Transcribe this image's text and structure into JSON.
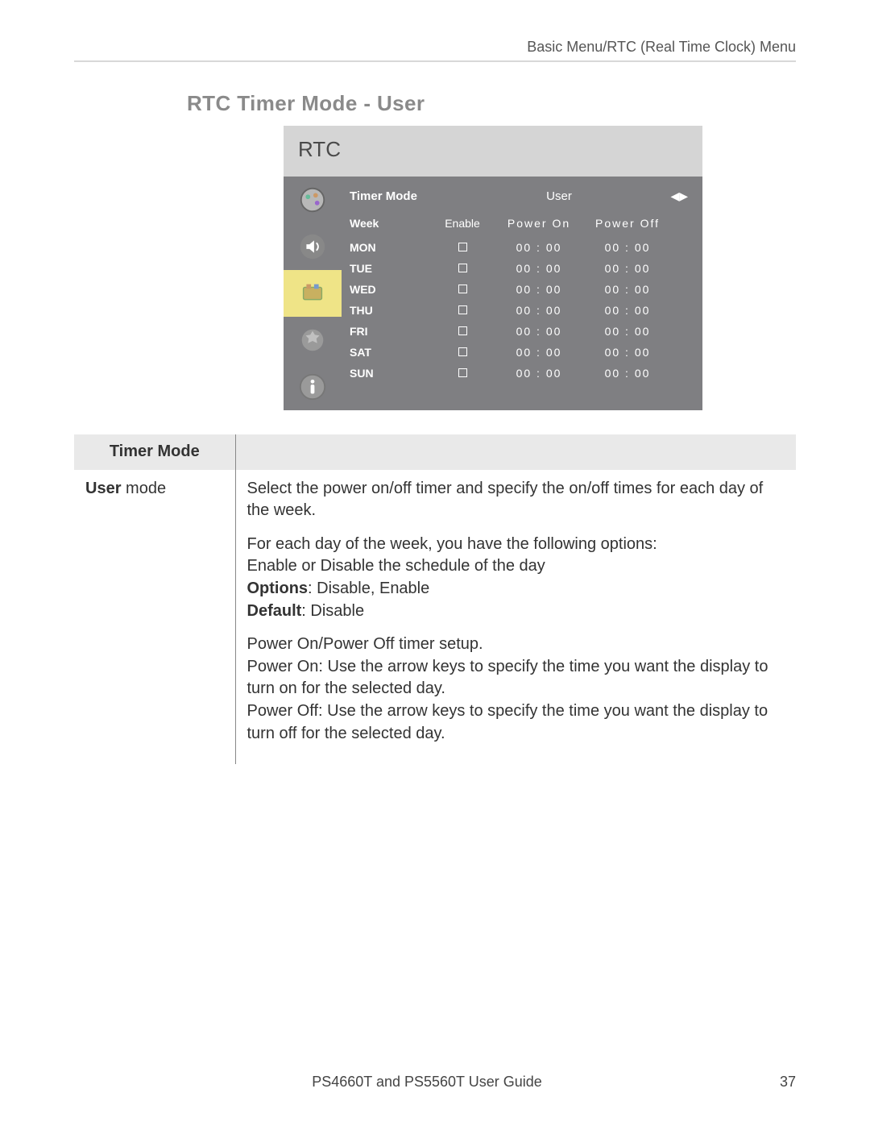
{
  "breadcrumb": "Basic Menu/RTC (Real Time Clock) Menu",
  "section_title": "RTC Timer Mode - User",
  "osd": {
    "title": "RTC",
    "mode_label": "Timer Mode",
    "mode_value": "User",
    "cols": {
      "week": "Week",
      "enable": "Enable",
      "on": "Power On",
      "off": "Power Off"
    },
    "rows": [
      {
        "day": "MON",
        "on": "00 : 00",
        "off": "00 : 00"
      },
      {
        "day": "TUE",
        "on": "00 : 00",
        "off": "00 : 00"
      },
      {
        "day": "WED",
        "on": "00 : 00",
        "off": "00 : 00"
      },
      {
        "day": "THU",
        "on": "00 : 00",
        "off": "00 : 00"
      },
      {
        "day": "FRI",
        "on": "00 : 00",
        "off": "00 : 00"
      },
      {
        "day": "SAT",
        "on": "00 : 00",
        "off": "00 : 00"
      },
      {
        "day": "SUN",
        "on": "00 : 00",
        "off": "00 : 00"
      }
    ]
  },
  "table": {
    "header": "Timer Mode",
    "row_label_bold": "User",
    "row_label_rest": " mode",
    "p1": "Select the power on/off timer and specify the on/off times for each day of the week.",
    "p2_l1": "For each day of the week, you have the following options:",
    "p2_l2": "Enable or Disable the schedule of the day",
    "p2_l3b": "Options",
    "p2_l3r": ": Disable, Enable",
    "p2_l4b": "Default",
    "p2_l4r": ": Disable",
    "p3_l1": "Power On/Power Off timer setup.",
    "p3_l2": "Power On: Use the arrow keys to specify the time you want the display to turn on for the selected day.",
    "p3_l3": "Power Off: Use the arrow keys to specify the time you want the display to turn off for the selected day."
  },
  "footer": {
    "center": "PS4660T and PS5560T User Guide",
    "page": "37"
  }
}
